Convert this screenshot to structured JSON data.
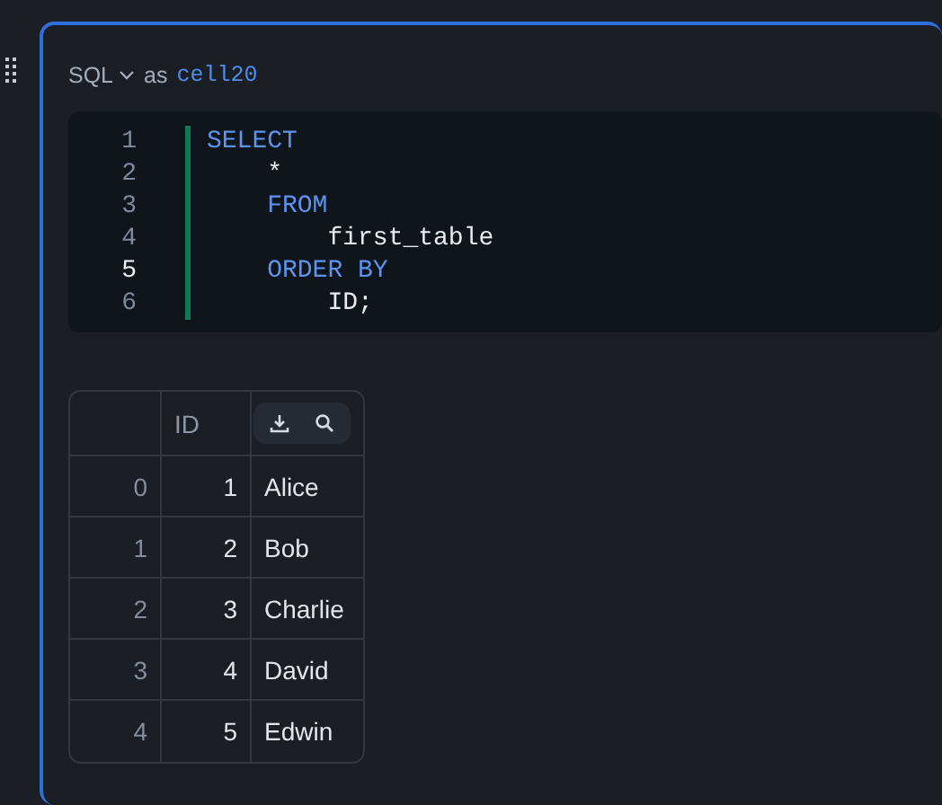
{
  "cell": {
    "language": "SQL",
    "as_label": "as",
    "name": "cell20"
  },
  "code": {
    "lines": [
      {
        "number": "1",
        "active": false,
        "text": "SELECT",
        "kind": "keyword"
      },
      {
        "number": "2",
        "active": false,
        "text": "    *",
        "kind": "plain"
      },
      {
        "number": "3",
        "active": false,
        "text": "    FROM",
        "kind": "keyword"
      },
      {
        "number": "4",
        "active": false,
        "text": "        first_table",
        "kind": "plain"
      },
      {
        "number": "5",
        "active": true,
        "text": "    ORDER BY",
        "kind": "keyword"
      },
      {
        "number": "6",
        "active": false,
        "text": "        ID;",
        "kind": "plain"
      }
    ]
  },
  "table": {
    "columns": [
      "",
      "ID"
    ],
    "rows": [
      [
        "0",
        "1",
        "Alice"
      ],
      [
        "1",
        "2",
        "Bob"
      ],
      [
        "2",
        "3",
        "Charlie"
      ],
      [
        "3",
        "4",
        "David"
      ],
      [
        "4",
        "5",
        "Edwin"
      ]
    ]
  }
}
